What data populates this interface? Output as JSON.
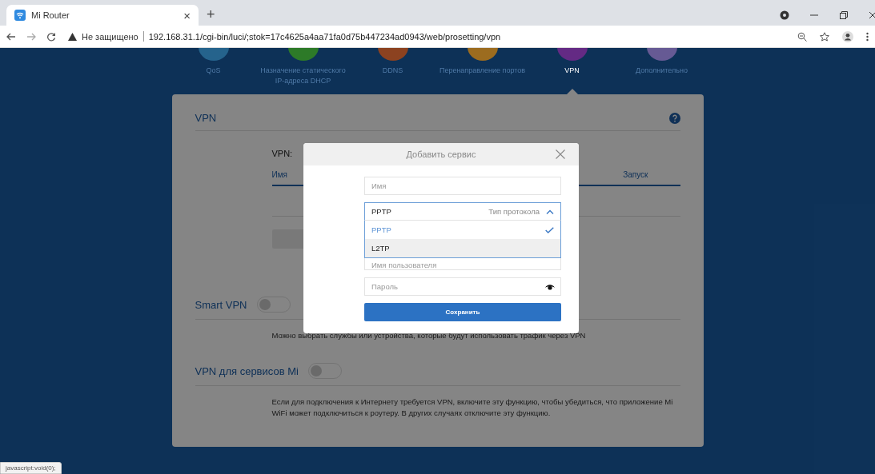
{
  "browser": {
    "tab": {
      "title": "Mi Router",
      "close": "×"
    },
    "new_tab": "+",
    "address": {
      "security": "Не защищено",
      "url": "192.168.31.1/cgi-bin/luci/;stok=17c4625a4aa71fa0d75b447234ad0943/web/prosetting/vpn"
    }
  },
  "nav": [
    {
      "label": "QoS",
      "color": "#25638c",
      "selected": false
    },
    {
      "label": "Назначение статического IP-адреса DHCP",
      "color": "#2d7a28",
      "selected": false
    },
    {
      "label": "DDNS",
      "color": "#8c4220",
      "selected": false
    },
    {
      "label": "Перенаправление портов",
      "color": "#9c6c1f",
      "selected": false
    },
    {
      "label": "VPN",
      "color": "#642a84",
      "selected": true
    },
    {
      "label": "Дополнительно",
      "color": "#665a94",
      "selected": false
    }
  ],
  "card": {
    "title": "VPN",
    "vpn_label": "VPN:",
    "columns": [
      "Имя",
      "Запуск"
    ],
    "toggles": [
      {
        "label": "Smart VPN",
        "on": false,
        "description": "Можно выбрать службы или устройства, которые будут использовать трафик через VPN"
      },
      {
        "label": "VPN для сервисов Mi",
        "on": false,
        "description": "Если для подключения к Интернету требуется VPN, включите эту функцию, чтобы убедиться, что приложение Mi WiFi может подключиться к роутеру. В других случаях отключите эту функцию."
      }
    ]
  },
  "modal": {
    "title": "Добавить сервис",
    "name": {
      "placeholder": "Имя"
    },
    "protocol": {
      "value": "PPTP",
      "hint": "Тип протокола",
      "expanded": true,
      "options": [
        {
          "label": "PPTP",
          "selected": true,
          "hovered": false
        },
        {
          "label": "L2TP",
          "selected": false,
          "hovered": true
        }
      ]
    },
    "username": {
      "placeholder": "Имя пользователя"
    },
    "password": {
      "placeholder": "Пароль"
    },
    "save": "Сохранить"
  },
  "status_bar": "javascript:void(0);"
}
